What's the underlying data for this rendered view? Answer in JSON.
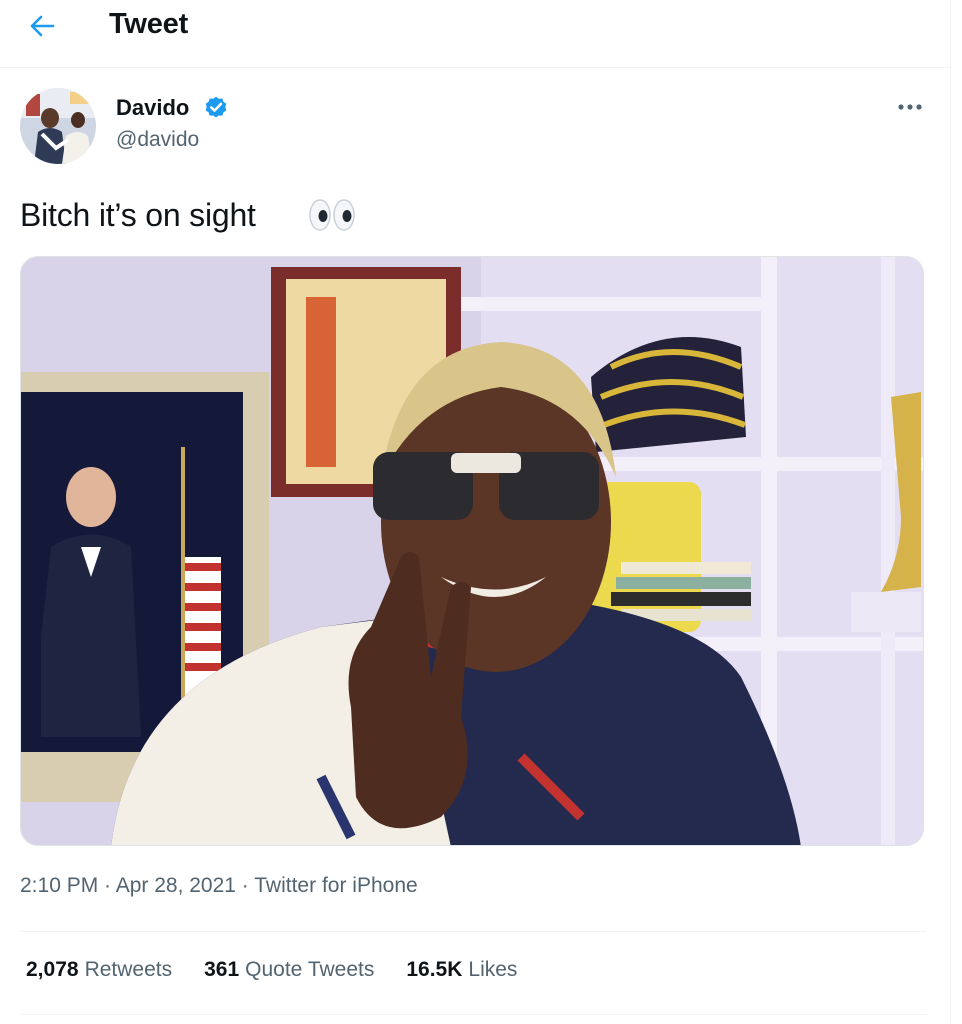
{
  "header": {
    "title": "Tweet"
  },
  "tweet": {
    "author": {
      "name": "Davido",
      "handle": "@davido",
      "verified": true
    },
    "text": "Bitch it’s on sight",
    "emoji_icon": "eyes-emoji-icon",
    "timestamp": "2:10 PM · Apr 28, 2021 · ",
    "source": "Twitter for iPhone"
  },
  "stats": {
    "retweets": {
      "count": "2,078",
      "label": "Retweets"
    },
    "quotes": {
      "count": "361",
      "label": "Quote Tweets"
    },
    "likes": {
      "count": "16.5K",
      "label": "Likes"
    }
  },
  "colors": {
    "accent": "#1d9bf0",
    "text": "#0f1419",
    "muted": "#536471",
    "border": "#eff3f4"
  }
}
